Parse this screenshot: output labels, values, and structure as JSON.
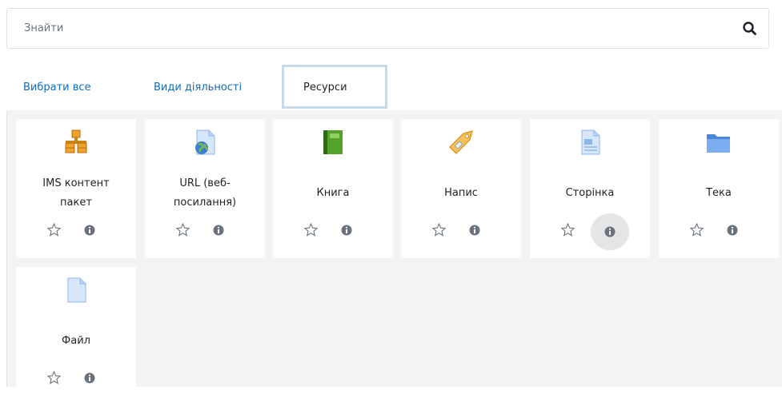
{
  "search": {
    "placeholder": "Знайти",
    "value": ""
  },
  "tabs": [
    {
      "label": "Вибрати все"
    },
    {
      "label": "Види діяльності"
    },
    {
      "label": "Ресурси",
      "active": true
    }
  ],
  "modules": [
    {
      "line1": "IMS контент",
      "line2": "пакет",
      "icon": "ims-package-icon"
    },
    {
      "line1": "URL (веб-",
      "line2": "посилання)",
      "icon": "url-icon"
    },
    {
      "line1": "Книга",
      "line2": "",
      "icon": "book-icon"
    },
    {
      "line1": "Напис",
      "line2": "",
      "icon": "label-icon"
    },
    {
      "line1": "Сторінка",
      "line2": "",
      "icon": "page-icon"
    },
    {
      "line1": "Тека",
      "line2": "",
      "icon": "folder-icon"
    },
    {
      "line1": "Файл",
      "line2": "",
      "icon": "file-icon"
    }
  ],
  "colors": {
    "link": "#0f6cbf",
    "tab_active_border": "#c7daea",
    "grid_bg": "#f1f3f4",
    "icon_grey": "#6a737b"
  }
}
